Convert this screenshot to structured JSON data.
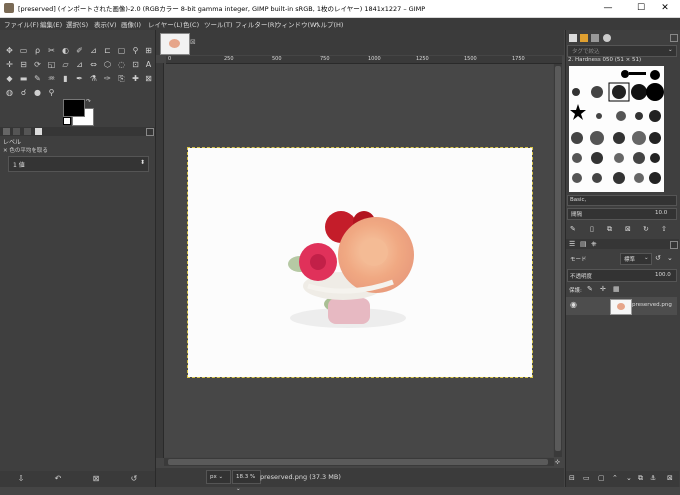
{
  "window": {
    "title": "[preserved] (インポートされた画像)-2.0 (RGBカラー 8-bit gamma integer, GIMP built-in sRGB, 1枚のレイヤー) 1841x1227 – GIMP",
    "minimize": "—",
    "maximize": "☐",
    "close": "✕"
  },
  "menu": [
    "ファイル(F)",
    "編集(E)",
    "選択(S)",
    "表示(V)",
    "画像(I)",
    "レイヤー(L)",
    "色(C)",
    "ツール(T)",
    "フィルター(R)",
    "ウィンドウ(W)",
    "ヘルプ(H)"
  ],
  "tool_options": {
    "title": "レベル",
    "pick_label": "色の平均を取る",
    "field_value": "1 値",
    "field_arrow": "⬍"
  },
  "brushes": {
    "filter_placeholder": "タグで絞込",
    "brush_name": "2. Hardness 050 (51 × 51)",
    "tag_value": "Basic,",
    "spacing_label": "間隔",
    "spacing_value": "10.0"
  },
  "layers": {
    "mode_label": "モード",
    "mode_value": "標準",
    "opacity_label": "不透明度",
    "opacity_value": "100.0",
    "lock_label": "保護:",
    "layer_name": "preserved.png"
  },
  "ruler_top": [
    "0",
    "250",
    "500",
    "750",
    "1000",
    "1250",
    "1500",
    "1750"
  ],
  "status": {
    "unit": "px",
    "zoom": "18.3 %",
    "text": "preserved.png (37.3 MB)"
  },
  "colors": {
    "dock_bg": "#3f3f3f",
    "canvas_bg": "#474747",
    "selection_border": "#d9c64a"
  }
}
